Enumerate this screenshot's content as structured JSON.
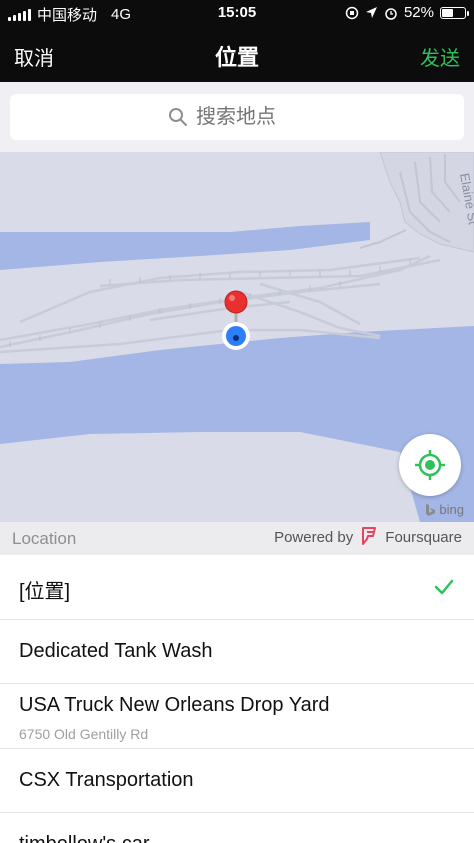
{
  "status_bar": {
    "carrier": "中国移动",
    "network": "4G",
    "time": "15:05",
    "battery_percent": "52%",
    "battery_level": 0.52
  },
  "nav": {
    "cancel_label": "取消",
    "title": "位置",
    "send_label": "发送",
    "send_color": "#2fc15b"
  },
  "search": {
    "placeholder": "搜索地点",
    "icon": "search-icon"
  },
  "map": {
    "street_label": "Elaine St",
    "attribution": "bing",
    "pin_color": "#e8302f",
    "user_dot_color": "#2d7ff9",
    "water_color": "#a3b6e6",
    "land_color": "#d9dbe8",
    "locate_icon": "locate-icon",
    "locate_color": "#2fc15b"
  },
  "location_header": {
    "label": "Location",
    "powered_by": "Powered by",
    "brand": "Foursquare",
    "brand_color": "#e6455f"
  },
  "places": [
    {
      "name": "[位置]",
      "address": "",
      "selected": true
    },
    {
      "name": "Dedicated Tank Wash",
      "address": "",
      "selected": false
    },
    {
      "name": "USA Truck New Orleans Drop Yard",
      "address": "6750 Old Gentilly Rd",
      "selected": false
    },
    {
      "name": "CSX Transportation",
      "address": "",
      "selected": false
    },
    {
      "name": "timbellow's car",
      "address": "",
      "selected": false
    }
  ]
}
